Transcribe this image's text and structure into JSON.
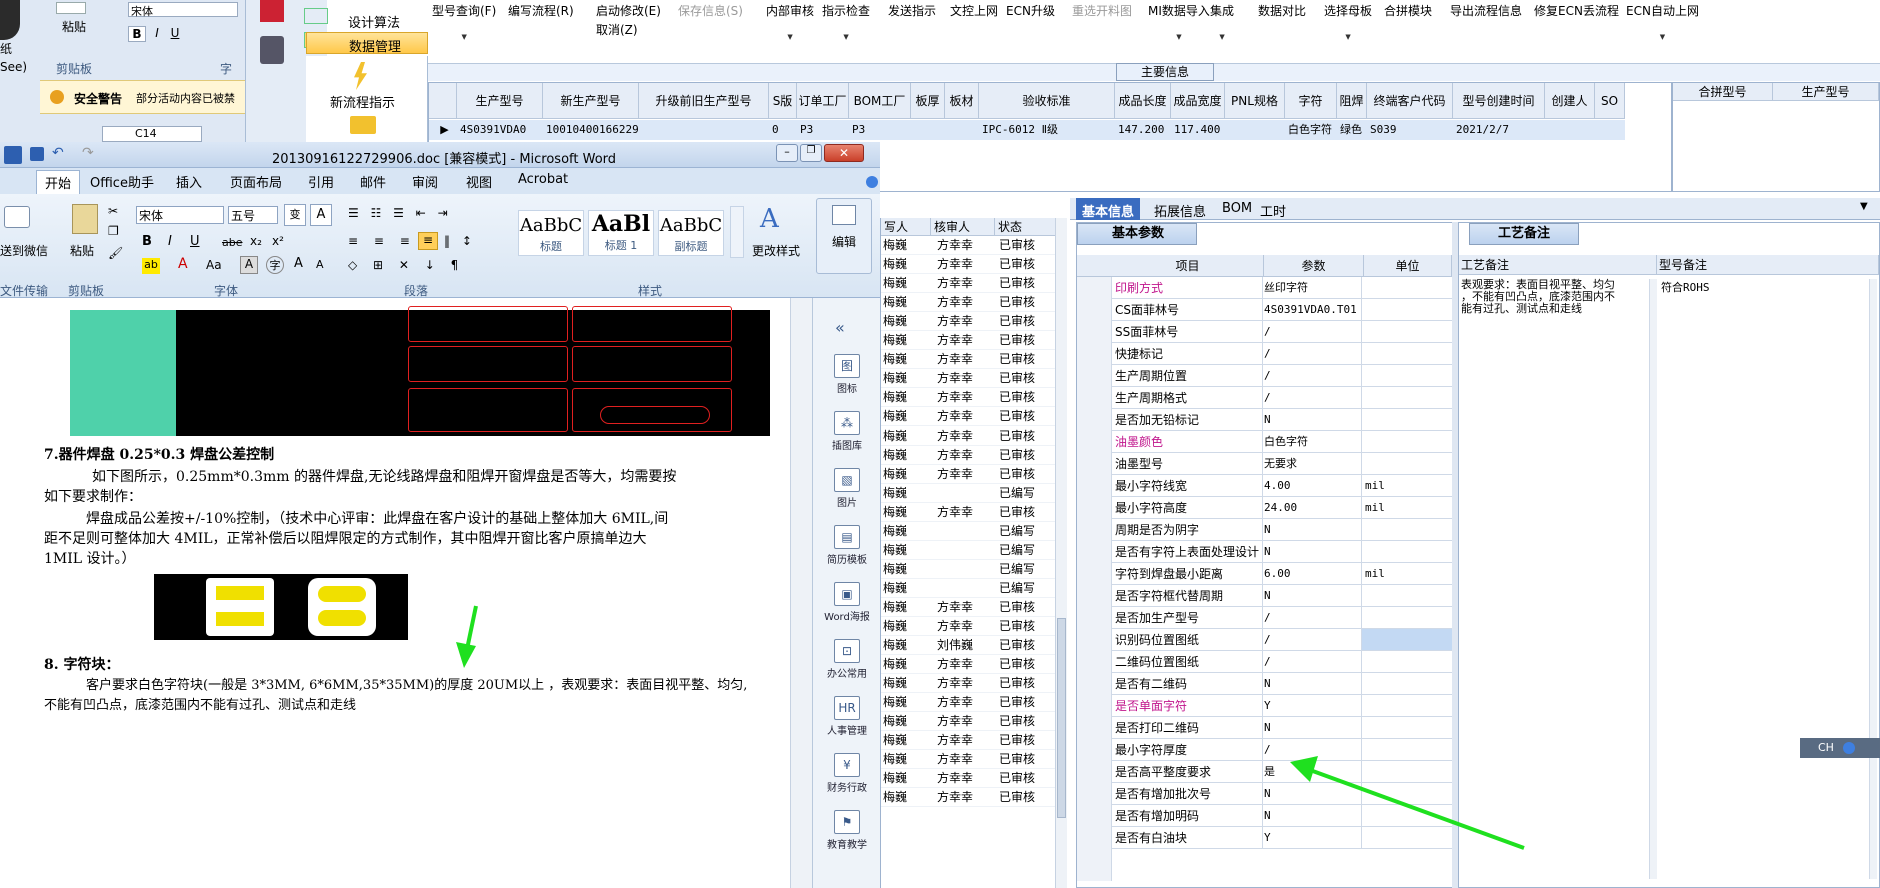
{
  "excel": {
    "font_name": "宋体",
    "clipboard_label": "剪贴板",
    "paste_label": "粘贴",
    "font_group_label": "字",
    "security_warning": "安全警告",
    "security_text": "部分活动内容已被禁",
    "cell_ref": "C14",
    "left_label_1": "纸",
    "left_label_2": "See)"
  },
  "erp_side": {
    "items": [
      {
        "label": "设计算法"
      },
      {
        "label": "数据管理",
        "selected": true
      }
    ],
    "new_flow_label": "新流程指示"
  },
  "top_menu": [
    {
      "label": "型号查询(F)",
      "disabled": false,
      "arrow": true
    },
    {
      "label": "编写流程(R)",
      "disabled": false,
      "arrow": false
    },
    {
      "label": "启动修改(E)",
      "sub": "取消(Z)",
      "disabled": false,
      "arrow": false
    },
    {
      "label": "保存信息(S)",
      "disabled": true,
      "arrow": false
    },
    {
      "label": "内部审核",
      "disabled": false,
      "arrow": true
    },
    {
      "label": "指示检查",
      "disabled": false,
      "arrow": true
    },
    {
      "label": "发送指示",
      "disabled": false,
      "arrow": false
    },
    {
      "label": "文控上网",
      "disabled": false,
      "arrow": false
    },
    {
      "label": "ECN升级",
      "disabled": false,
      "arrow": false
    },
    {
      "label": "重选开料图",
      "disabled": true,
      "arrow": false
    },
    {
      "label": "MI数据导入",
      "disabled": false,
      "arrow": true
    },
    {
      "label": "集成",
      "disabled": false,
      "arrow": true
    },
    {
      "label": "数据对比",
      "disabled": false,
      "arrow": false
    },
    {
      "label": "选择母板",
      "disabled": false,
      "arrow": true
    },
    {
      "label": "合拼模块",
      "disabled": false,
      "arrow": false
    },
    {
      "label": "导出流程信息",
      "disabled": false,
      "arrow": false
    },
    {
      "label": "修复ECN丢流程",
      "disabled": false,
      "arrow": false
    },
    {
      "label": "ECN自动上网",
      "disabled": false,
      "arrow": true
    }
  ],
  "main_info": {
    "title": "主要信息",
    "columns": [
      "生产型号",
      "新生产型号",
      "升级前旧生产型号",
      "S版",
      "订单工厂",
      "BOM工厂",
      "板厚",
      "板材",
      "验收标准",
      "成品长度",
      "成品宽度",
      "PNL规格",
      "字符",
      "阻焊",
      "终端客户代码",
      "型号创建时间",
      "创建人",
      "SO"
    ],
    "row": [
      "4S0391VDA0",
      "10010400166229",
      "",
      "0",
      "P3",
      "P3",
      "",
      "",
      "IPC-6012 Ⅱ级",
      "147.200",
      "117.400",
      "",
      "白色字符",
      "绿色",
      "S039",
      "2021/2/7",
      "",
      ""
    ],
    "merge_columns": [
      "合拼型号",
      "生产型号"
    ]
  },
  "word": {
    "title": "20130916122729906.doc [兼容模式] - Microsoft Word",
    "tabs": [
      "开始",
      "Office助手",
      "插入",
      "页面布局",
      "引用",
      "邮件",
      "审阅",
      "视图",
      "Acrobat"
    ],
    "font": "宋体",
    "font_size": "五号",
    "groups": [
      "文件传输",
      "剪贴板",
      "字体",
      "段落",
      "样式",
      "编辑"
    ],
    "send_wechat": "送到微信",
    "paste": "粘贴",
    "styles": [
      {
        "sample": "AaBbC",
        "name": "标题"
      },
      {
        "sample": "AaBl",
        "name": "标题 1"
      },
      {
        "sample": "AaBbC",
        "name": "副标题"
      }
    ],
    "change_style": "更改样式",
    "edit": "编辑",
    "doc": {
      "h7": "7.器件焊盘 0.25*0.3 焊盘公差控制",
      "p1a": "如下图所示，0.25mm*0.3mm 的器件焊盘,无论线路焊盘和阻焊开窗焊盘是否等大，均需要按",
      "p1b": "如下要求制作：",
      "p2a": "焊盘成品公差按+/-10%控制，（技术中心评审：此焊盘在客户设计的基础上整体加大 6MIL,间",
      "p2b": "距不足则可整体加大 4MIL，正常补偿后以阻焊限定的方式制作，其中阻焊开窗比客户原搞单边大",
      "p2c": "1MIL 设计。）",
      "h8": "8. 字符块：",
      "p3a": "客户要求白色字符块(一般是 3*3MM, 6*6MM,35*35MM)的厚度 20UM以上 ，表观要求：表面目视平整、均匀,",
      "p3b": "不能有凹凸点，底漆范围内不能有过孔、测试点和走线"
    },
    "sidebar": [
      "图标",
      "插图库",
      "图片",
      "简历模板",
      "Word海报",
      "办公常用",
      "人事管理",
      "财务行政",
      "教育教学"
    ]
  },
  "middle_list": {
    "columns": [
      "写人",
      "核审人",
      "状态"
    ],
    "rows": [
      [
        "梅巍",
        "方幸幸",
        "已审核"
      ],
      [
        "梅巍",
        "方幸幸",
        "已审核"
      ],
      [
        "梅巍",
        "方幸幸",
        "已审核"
      ],
      [
        "梅巍",
        "方幸幸",
        "已审核"
      ],
      [
        "梅巍",
        "方幸幸",
        "已审核"
      ],
      [
        "梅巍",
        "方幸幸",
        "已审核"
      ],
      [
        "梅巍",
        "方幸幸",
        "已审核"
      ],
      [
        "梅巍",
        "方幸幸",
        "已审核"
      ],
      [
        "梅巍",
        "方幸幸",
        "已审核"
      ],
      [
        "梅巍",
        "方幸幸",
        "已审核"
      ],
      [
        "梅巍",
        "方幸幸",
        "已审核"
      ],
      [
        "梅巍",
        "方幸幸",
        "已审核"
      ],
      [
        "梅巍",
        "方幸幸",
        "已审核"
      ],
      [
        "梅巍",
        "",
        "已编写"
      ],
      [
        "梅巍",
        "方幸幸",
        "已审核"
      ],
      [
        "梅巍",
        "",
        "已编写"
      ],
      [
        "梅巍",
        "",
        "已编写"
      ],
      [
        "梅巍",
        "",
        "已编写"
      ],
      [
        "梅巍",
        "",
        "已编写"
      ],
      [
        "梅巍",
        "方幸幸",
        "已审核"
      ],
      [
        "梅巍",
        "方幸幸",
        "已审核"
      ],
      [
        "梅巍",
        "刘伟巍",
        "已审核"
      ],
      [
        "梅巍",
        "方幸幸",
        "已审核"
      ],
      [
        "梅巍",
        "方幸幸",
        "已审核"
      ],
      [
        "梅巍",
        "方幸幸",
        "已审核"
      ],
      [
        "梅巍",
        "方幸幸",
        "已审核"
      ],
      [
        "梅巍",
        "方幸幸",
        "已审核"
      ],
      [
        "梅巍",
        "方幸幸",
        "已审核"
      ],
      [
        "梅巍",
        "方幸幸",
        "已审核"
      ],
      [
        "梅巍",
        "方幸幸",
        "已审核"
      ]
    ]
  },
  "right_tabs": [
    "基本信息",
    "拓展信息",
    "BOM",
    "工时"
  ],
  "basic_params": {
    "title": "基本参数",
    "columns": [
      "项目",
      "参数",
      "单位"
    ],
    "rows": [
      {
        "k": "印刷方式",
        "v": "丝印字符",
        "u": "",
        "hl": true
      },
      {
        "k": "CS面菲林号",
        "v": "4S0391VDA0.T01",
        "u": "",
        "hl": false
      },
      {
        "k": "SS面菲林号",
        "v": "/",
        "u": "",
        "hl": false
      },
      {
        "k": "快捷标记",
        "v": "/",
        "u": "",
        "hl": false
      },
      {
        "k": "生产周期位置",
        "v": "/",
        "u": "",
        "hl": false
      },
      {
        "k": "生产周期格式",
        "v": "/",
        "u": "",
        "hl": false
      },
      {
        "k": "是否加无铅标记",
        "v": "N",
        "u": "",
        "hl": false
      },
      {
        "k": "油墨颜色",
        "v": "白色字符",
        "u": "",
        "hl": true
      },
      {
        "k": "油墨型号",
        "v": "无要求",
        "u": "",
        "hl": false
      },
      {
        "k": "最小字符线宽",
        "v": "4.00",
        "u": "mil",
        "hl": false
      },
      {
        "k": "最小字符高度",
        "v": "24.00",
        "u": "mil",
        "hl": false
      },
      {
        "k": "周期是否为阴字",
        "v": "N",
        "u": "",
        "hl": false
      },
      {
        "k": "是否有字符上表面处理设计",
        "v": "N",
        "u": "",
        "hl": false
      },
      {
        "k": "字符到焊盘最小距离",
        "v": "6.00",
        "u": "mil",
        "hl": false
      },
      {
        "k": "是否字符框代替周期",
        "v": "N",
        "u": "",
        "hl": false
      },
      {
        "k": "是否加生产型号",
        "v": "/",
        "u": "",
        "hl": false
      },
      {
        "k": "识别码位置图纸",
        "v": "/",
        "u": "",
        "hl": false
      },
      {
        "k": "二维码位置图纸",
        "v": "/",
        "u": "",
        "hl": false
      },
      {
        "k": "是否有二维码",
        "v": "N",
        "u": "",
        "hl": false
      },
      {
        "k": "是否单面字符",
        "v": "Y",
        "u": "",
        "hl": true
      },
      {
        "k": "是否打印二维码",
        "v": "N",
        "u": "",
        "hl": false
      },
      {
        "k": "最小字符厚度",
        "v": "/",
        "u": "",
        "hl": false
      },
      {
        "k": "是否高平整度要求",
        "v": "是",
        "u": "",
        "hl": false
      },
      {
        "k": "是否有增加批次号",
        "v": "N",
        "u": "",
        "hl": false
      },
      {
        "k": "是否有增加明码",
        "v": "N",
        "u": "",
        "hl": false
      },
      {
        "k": "是否有白油块",
        "v": "Y",
        "u": "",
        "hl": false
      }
    ]
  },
  "craft_notes": {
    "title": "工艺备注",
    "col1": "工艺备注",
    "col2": "型号备注",
    "note_lines": [
      "表观要求：表面目视平整、均匀",
      "，不能有凹凸点，底漆范围内不",
      "能有过孔、测试点和走线"
    ],
    "model_note": "符合ROHS"
  },
  "ime": {
    "label": "CH"
  },
  "colors": {
    "annotation_arrow": "#1fe01f",
    "highlight_key": "#c0158c",
    "selected_blue": "#c3d9f3"
  }
}
